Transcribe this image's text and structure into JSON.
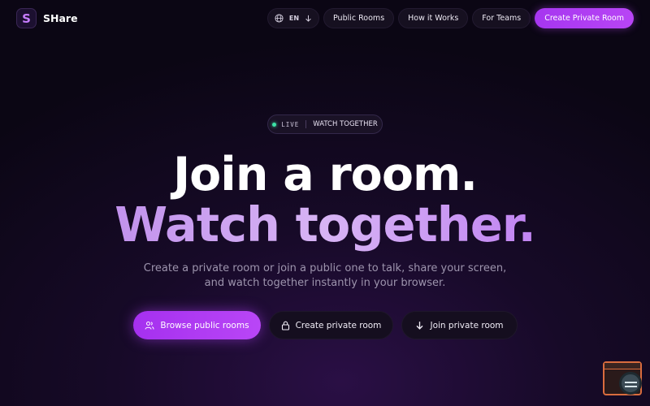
{
  "brand": {
    "logo_letter": "S",
    "name": "SHare"
  },
  "nav": {
    "language_code": "EN",
    "public_rooms": "Public Rooms",
    "how_it_works": "How it Works",
    "for_teams": "For Teams",
    "create_private_room": "Create Private Room"
  },
  "badge": {
    "live": "LIVE",
    "text": "WATCH TOGETHER"
  },
  "hero": {
    "line1": "Join a room.",
    "line2": "Watch together.",
    "sub_line1": "Create a private room or join a public one to talk, share your screen,",
    "sub_line2": "and watch together instantly in your browser."
  },
  "actions": {
    "browse": "Browse public rooms",
    "create": "Create private room",
    "join": "Join private room"
  },
  "colors": {
    "accent": "#b246f5",
    "live_dot": "#3ce2a6",
    "background": "#0b0614"
  },
  "icons": [
    "globe-icon",
    "arrow-down-icon",
    "users-icon",
    "lock-icon",
    "arrow-down-icon",
    "widget-icon"
  ]
}
